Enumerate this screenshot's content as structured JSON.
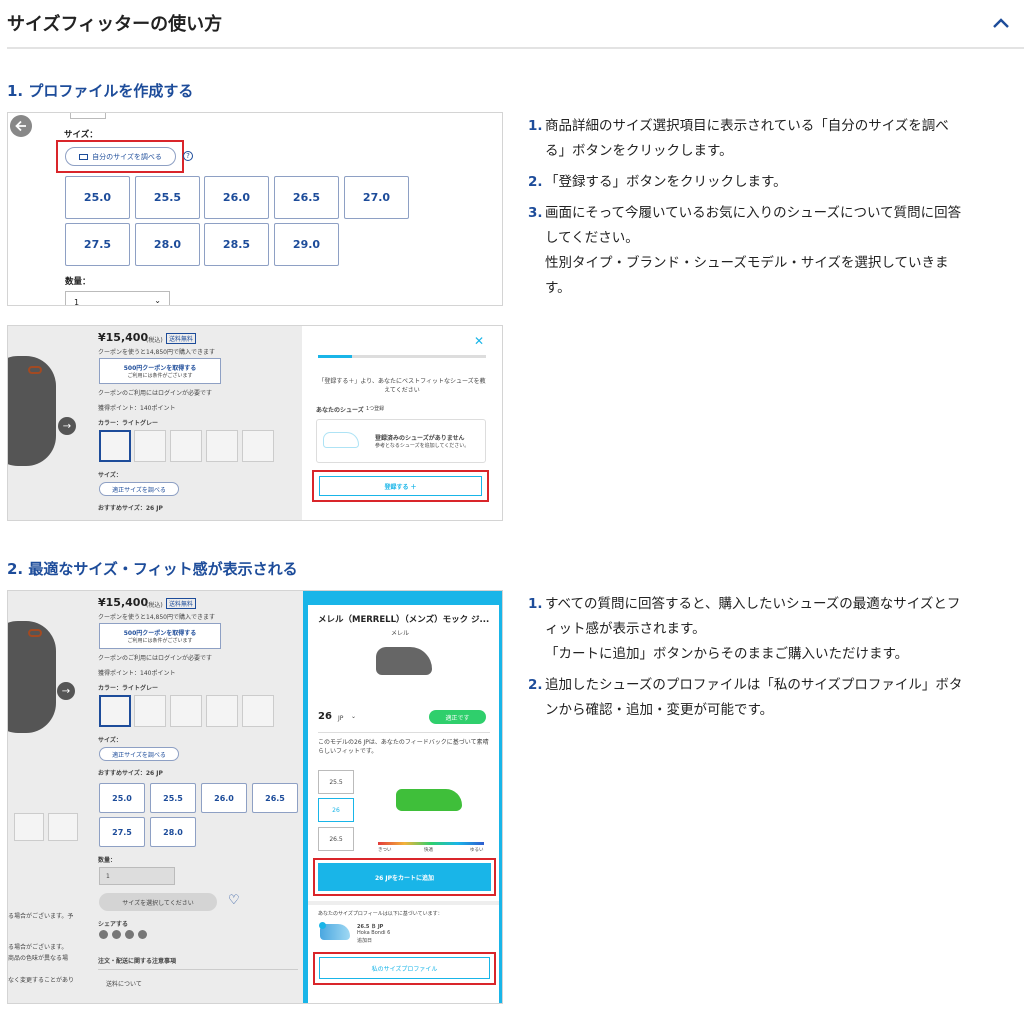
{
  "header": {
    "title": "サイズフィッターの使い方"
  },
  "section1": {
    "title": "1. プロファイルを作成する",
    "shotA": {
      "size_label": "サイズ：",
      "find_btn": "自分のサイズを調べる",
      "sizes": [
        "25.0",
        "25.5",
        "26.0",
        "26.5",
        "27.0",
        "27.5",
        "28.0",
        "28.5",
        "29.0"
      ],
      "qty_label": "数量：",
      "qty_value": "1"
    },
    "shotB": {
      "price": "¥15,400",
      "tax": "(税込)",
      "ship": "送料無料",
      "coupon_note": "クーポンを使うと14,850円で購入できます",
      "coupon_btn": "500円クーポンを取得する",
      "coupon_sub": "ご利用には条件がございます",
      "login_note": "クーポンのご利用にはログインが必要です",
      "points": "獲得ポイント：140ポイント",
      "color": "カラー：ライトグレー",
      "size_label": "サイズ：",
      "find_btn": "適正サイズを調べる",
      "rec": "おすすめサイズ：26 JP",
      "panel_text": "「登録する＋」より、あなたにベストフィットなシューズを教えてください",
      "your_shoes": "あなたのシューズ",
      "count": "1つ登録",
      "none_title": "登録済みのシューズがありません",
      "none_sub": "参考となるシューズを追加してください。",
      "register": "登録する ＋"
    },
    "steps": [
      {
        "num": "1.",
        "lines": [
          "商品詳細のサイズ選択項目に表示されている「自分のサイズを調べ",
          "る」ボタンをクリックします。"
        ]
      },
      {
        "num": "2.",
        "lines": [
          "「登録する」ボタンをクリックします。"
        ]
      },
      {
        "num": "3.",
        "lines": [
          "画面にそって今履いているお気に入りのシューズについて質問に回答",
          "してください。",
          "性別タイプ・ブランド・シューズモデル・サイズを選択していきま",
          "す。"
        ]
      }
    ]
  },
  "section2": {
    "title": "2. 最適なサイズ・フィット感が表示される",
    "shotC": {
      "price": "¥15,400",
      "tax": "(税込)",
      "ship": "送料無料",
      "coupon_note": "クーポンを使うと14,850円で購入できます",
      "coupon_btn": "500円クーポンを取得する",
      "coupon_sub": "ご利用には条件がございます",
      "login_note": "クーポンのご利用にはログインが必要です",
      "points": "獲得ポイント：140ポイント",
      "color": "カラー：ライトグレー",
      "size_label": "サイズ：",
      "find_btn": "適正サイズを調べる",
      "rec": "おすすめサイズ：26 JP",
      "sizes": [
        "25.0",
        "25.5",
        "26.0",
        "26.5",
        "27.5",
        "28.0"
      ],
      "qty_label": "数量：",
      "qty_value": "1",
      "select_btn": "サイズを選択してください",
      "share": "シェアする",
      "order_note": "注文・配送に関する注意事項",
      "ship_label": "送料について",
      "left_cut1": "る場合がございます。予",
      "left_cut2": "る場合がございます。",
      "left_cut3": "商品の色味が異なる場",
      "left_cut4": "なく変更することがあり",
      "panel_title": "メレル（MERRELL）（メンズ）モック ジ...",
      "panel_brand": "メレル",
      "size_value": "26",
      "size_unit": "JP",
      "fit_badge": "適正です",
      "fit_text": "このモデルの26 JPは、あなたのフィードバックに基づいて素晴らしいフィットです。",
      "fit_sizes": [
        "25.5",
        "26",
        "26.5"
      ],
      "scale": [
        "きつい",
        "快適",
        "ゆるい"
      ],
      "add_cart": "26 JPをカートに追加",
      "profile_note": "あなたのサイズプロフィールは以下に基づいています：",
      "profile_size": "26.5 Ｂ JP",
      "profile_model": "Hoka Bondi 6",
      "profile_date": "追加日",
      "profile_btn": "私のサイズプロファイル"
    },
    "steps": [
      {
        "num": "1.",
        "lines": [
          "すべての質問に回答すると、購入したいシューズの最適なサイズとフ",
          "ィット感が表示されます。",
          "「カートに追加」ボタンからそのままご購入いただけます。"
        ]
      },
      {
        "num": "2.",
        "lines": [
          "追加したシューズのプロファイルは「私のサイズプロファイル」ボタ",
          "ンから確認・追加・変更が可能です。"
        ]
      }
    ]
  },
  "colors": {
    "accent": "#1d4c9a",
    "highlight": "#d9252a",
    "cyan": "#19b5e8",
    "green": "#2fcf6c"
  }
}
